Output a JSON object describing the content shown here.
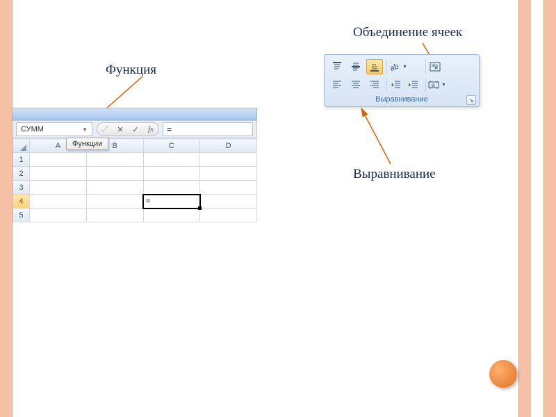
{
  "labels": {
    "function": "Функция",
    "merge_cells": "Объединение ячеек",
    "alignment": "Выравнивание"
  },
  "colors": {
    "arrow": "#e06000",
    "accent_bar": "#f6c0a6",
    "ribbon_title": "#3a6ea5",
    "nav_button": "#e07020"
  },
  "excel_fragment": {
    "name_box_value": "СУММ",
    "tooltip": "Функции",
    "formula_bar_value": "=",
    "fn_buttons": {
      "cancel": "✕",
      "confirm": "✓",
      "fx": "fx"
    },
    "column_headers": [
      "A",
      "B",
      "C",
      "D"
    ],
    "row_headers": [
      "1",
      "2",
      "3",
      "4",
      "5"
    ],
    "active_cell": {
      "row": 4,
      "col": "C",
      "display": "="
    }
  },
  "ribbon": {
    "group_title": "Выравнивание",
    "buttons_row1": [
      {
        "name": "align-top",
        "active": false
      },
      {
        "name": "align-middle",
        "active": false
      },
      {
        "name": "align-bottom",
        "active": true
      },
      {
        "name": "orientation",
        "active": false,
        "dropdown": true
      },
      {
        "name": "wrap-text",
        "active": false
      }
    ],
    "buttons_row2": [
      {
        "name": "align-left",
        "active": false
      },
      {
        "name": "align-center",
        "active": false
      },
      {
        "name": "align-right",
        "active": false
      },
      {
        "name": "decrease-indent",
        "active": false
      },
      {
        "name": "increase-indent",
        "active": false
      },
      {
        "name": "merge-center",
        "active": false,
        "dropdown": true
      }
    ]
  }
}
